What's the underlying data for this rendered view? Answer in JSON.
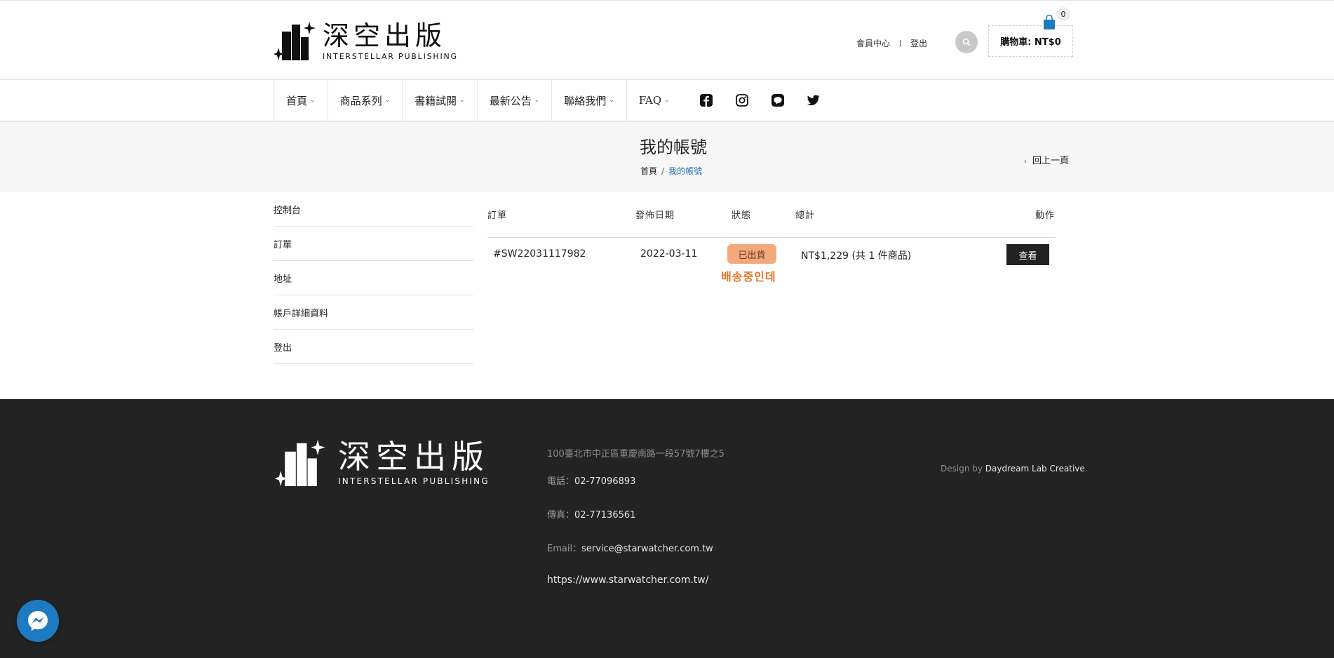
{
  "brand": {
    "name_cn": "深空出版",
    "name_en": "INTERSTELLAR PUBLISHING"
  },
  "header": {
    "member_center": "會員中心",
    "logout": "登出",
    "cart_label": "購物車: NT$0",
    "cart_count": "0"
  },
  "nav": {
    "items": [
      {
        "label": "首頁"
      },
      {
        "label": "商品系列"
      },
      {
        "label": "書籍試閱"
      },
      {
        "label": "最新公告"
      },
      {
        "label": "聯絡我們"
      },
      {
        "label": "FAQ"
      }
    ],
    "social_icons": [
      "facebook-icon",
      "instagram-icon",
      "line-icon",
      "twitter-icon"
    ]
  },
  "page": {
    "title": "我的帳號",
    "breadcrumb_home": "首頁",
    "breadcrumb_sep": "/",
    "breadcrumb_current": "我的帳號",
    "back_label": "回上一頁"
  },
  "sidebar": {
    "items": [
      {
        "label": "控制台"
      },
      {
        "label": "訂單"
      },
      {
        "label": "地址"
      },
      {
        "label": "帳戶詳細資料"
      },
      {
        "label": "登出"
      }
    ]
  },
  "orders": {
    "headers": {
      "order": "訂單",
      "date": "發佈日期",
      "status": "狀態",
      "total": "總計",
      "action": "動作"
    },
    "rows": [
      {
        "order_id": "#SW22031117982",
        "date": "2022-03-11",
        "status": "已出貨",
        "status_note": "배송중인데",
        "total": "NT$1,229 (共 1 件商品)",
        "action": "查看"
      }
    ]
  },
  "footer": {
    "address": "100臺北市中正區重慶南路一段57號7樓之5",
    "phone_label": "電話：",
    "phone": "02-77096893",
    "fax_label": "傳真：",
    "fax": "02-77136561",
    "email_label": "Email：",
    "email": "service@starwatcher.com.tw",
    "url": "https://www.starwatcher.com.tw/",
    "design_prefix": "Design by ",
    "design_by": "Daydream Lab Creative",
    "design_suffix": "."
  },
  "colors": {
    "accent_blue": "#2a6fb0",
    "status_badge": "#f2a97c",
    "status_note": "#e8742a",
    "footer_bg": "#232323",
    "cart_icon": "#1f7bc1"
  }
}
